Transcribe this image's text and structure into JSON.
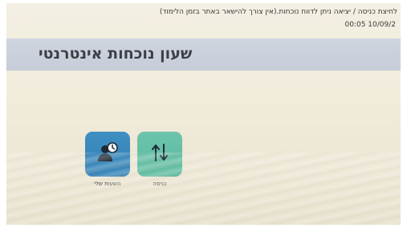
{
  "header": {
    "instruction_text": "לחיצת כניסה / יציאה ניתן לדווח נוכחות.(אין צורך להישאר באתר בזמן הלימוד)",
    "clock_text": "00:05 10/09/2"
  },
  "main": {
    "title": "שעון נוכחות אינטרנטי"
  },
  "tiles": [
    {
      "label": "השעות שלי",
      "icon": "user-clock-icon",
      "color": "#3a8abf"
    },
    {
      "label": "כניסה",
      "icon": "up-down-arrows-icon",
      "color": "#62bea4"
    }
  ]
}
